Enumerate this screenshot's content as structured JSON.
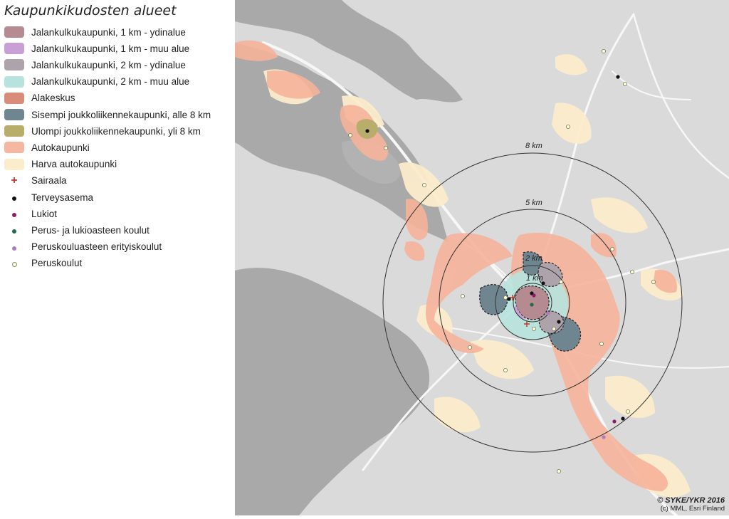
{
  "legend": {
    "title": "Kaupunkikudosten alueet",
    "items": [
      {
        "label": "Jalankulkukaupunki, 1 km - ydinalue",
        "color": "#b58a90",
        "type": "area",
        "icon": "swatch"
      },
      {
        "label": "Jalankulkukaupunki, 1 km - muu alue",
        "color": "#c9a0d6",
        "type": "area",
        "icon": "swatch"
      },
      {
        "label": "Jalankulkukaupunki, 2 km - ydinalue",
        "color": "#aea3aa",
        "type": "area",
        "icon": "swatch"
      },
      {
        "label": "Jalankulkukaupunki, 2 km - muu alue",
        "color": "#b6e3dd",
        "type": "area",
        "icon": "swatch"
      },
      {
        "label": "Alakeskus",
        "color": "#d98c7a",
        "type": "area",
        "icon": "swatch"
      },
      {
        "label": "Sisempi joukkoliikennekaupunki, alle 8 km",
        "color": "#6f8590",
        "type": "area",
        "icon": "swatch"
      },
      {
        "label": "Ulompi joukkoliikennekaupunki, yli 8 km",
        "color": "#b9ad6c",
        "type": "area",
        "icon": "swatch"
      },
      {
        "label": "Autokaupunki",
        "color": "#f6b7a0",
        "type": "area",
        "icon": "swatch"
      },
      {
        "label": "Harva autokaupunki",
        "color": "#fbeccb",
        "type": "area",
        "icon": "swatch"
      },
      {
        "label": "Sairaala",
        "color": "#c0392b",
        "type": "cross",
        "icon": "hospital-cross-icon"
      },
      {
        "label": "Terveysasema",
        "color": "#111111",
        "type": "dot",
        "icon": "health-station-dot-icon"
      },
      {
        "label": "Lukiot",
        "color": "#8e1a6e",
        "type": "dot",
        "icon": "upper-secondary-dot-icon"
      },
      {
        "label": "Perus- ja lukioasteen koulut",
        "color": "#1f6b4a",
        "type": "dot",
        "icon": "comprehensive-school-dot-icon"
      },
      {
        "label": "Peruskouluasteen erityiskoulut",
        "color": "#b07ac0",
        "type": "dot",
        "icon": "special-school-dot-icon"
      },
      {
        "label": "Peruskoulut",
        "color": "#ffffcc",
        "type": "ring",
        "icon": "basic-school-dot-icon"
      }
    ]
  },
  "map": {
    "rings": [
      {
        "label": "8 km",
        "radius_km": 8
      },
      {
        "label": "5 km",
        "radius_km": 5
      },
      {
        "label": "2 km",
        "radius_km": 2
      },
      {
        "label": "1 km",
        "radius_km": 1
      }
    ],
    "colors": {
      "water": "#a8a8a8",
      "land": "#dcdcdc",
      "road": "#f5f5f5"
    }
  },
  "copyright": {
    "line1": "© SYKE/YKR 2016",
    "line2": "(c) MML, Esri Finland"
  }
}
